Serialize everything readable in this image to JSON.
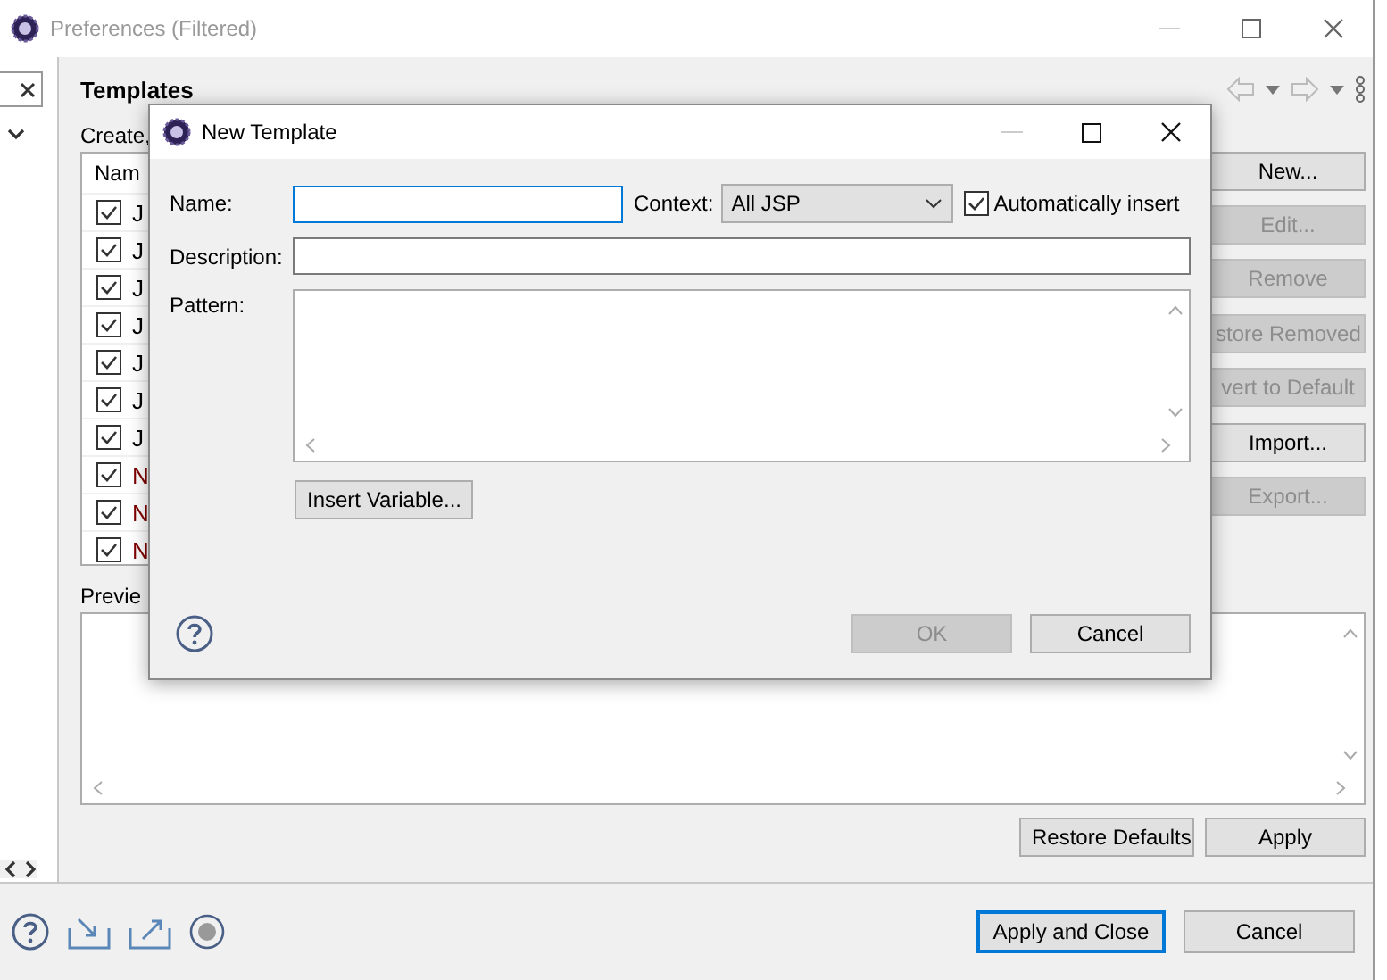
{
  "window": {
    "title": "Preferences (Filtered)"
  },
  "tree": {
    "expanded": true
  },
  "page": {
    "title": "Templates",
    "description": "Create,"
  },
  "table": {
    "columns": [
      "Nam"
    ],
    "rows": [
      {
        "name": "J",
        "checked": true,
        "color": "#000000"
      },
      {
        "name": "J",
        "checked": true,
        "color": "#000000"
      },
      {
        "name": "J",
        "checked": true,
        "color": "#000000"
      },
      {
        "name": "J",
        "checked": true,
        "color": "#000000"
      },
      {
        "name": "J",
        "checked": true,
        "color": "#000000"
      },
      {
        "name": "J",
        "checked": true,
        "color": "#000000"
      },
      {
        "name": "J",
        "checked": true,
        "color": "#000000"
      },
      {
        "name": "N",
        "checked": true,
        "color": "#7f0000"
      },
      {
        "name": "N",
        "checked": true,
        "color": "#7f0000"
      },
      {
        "name": "N",
        "checked": true,
        "color": "#7f0000"
      }
    ]
  },
  "side_buttons": [
    [
      {
        "label": "New...",
        "disabled": false
      },
      {
        "label": "Edit...",
        "disabled": true
      },
      {
        "label": "Remove",
        "disabled": true
      }
    ],
    [
      {
        "label": "store Removed",
        "disabled": true
      },
      {
        "label": "vert to Default",
        "disabled": true
      }
    ],
    [
      {
        "label": "Import...",
        "disabled": false
      },
      {
        "label": "Export...",
        "disabled": true
      }
    ]
  ],
  "preview": {
    "label": "Previe"
  },
  "page_buttons": [
    "Restore Defaults",
    "Apply"
  ],
  "footer_buttons": [
    {
      "label": "Apply and Close",
      "default": true
    },
    {
      "label": "Cancel",
      "default": false
    }
  ],
  "dialog": {
    "title": "New Template",
    "name": {
      "label": "Name:",
      "focused": true
    },
    "context": {
      "label": "Context:",
      "value": "All JSP"
    },
    "auto_insert": {
      "label": "Automatically insert",
      "checked": true
    },
    "description": {
      "label": "Description:"
    },
    "pattern": {
      "label": "Pattern:"
    },
    "insert_variable": "Insert Variable...",
    "buttons": [
      {
        "label": "OK",
        "disabled": true
      },
      {
        "label": "Cancel",
        "disabled": false
      }
    ]
  }
}
